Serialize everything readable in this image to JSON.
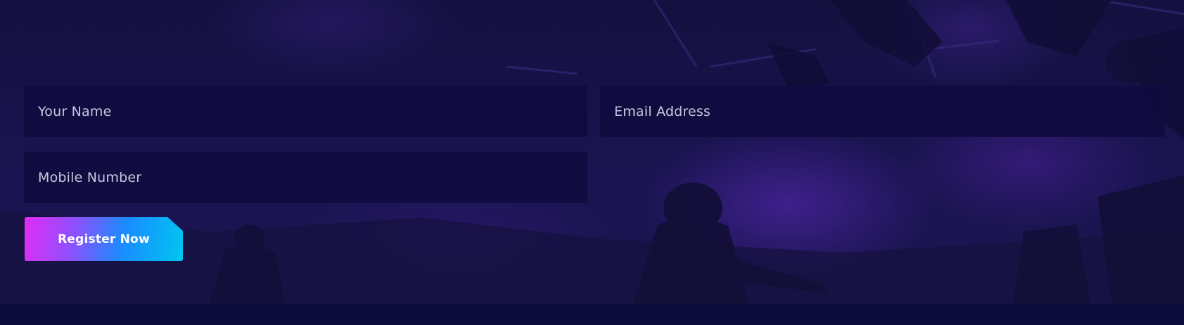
{
  "form": {
    "name_placeholder": "Your Name",
    "email_placeholder": "Email Address",
    "mobile_placeholder": "Mobile Number",
    "submit_label": "Register Now"
  },
  "colors": {
    "page_background": "#0e0c3c",
    "field_background": "#100c40",
    "placeholder_text": "#c9c7df",
    "button_gradient": [
      "#e02cf2",
      "#8c52ff",
      "#1a8cff",
      "#00c6f0"
    ]
  }
}
